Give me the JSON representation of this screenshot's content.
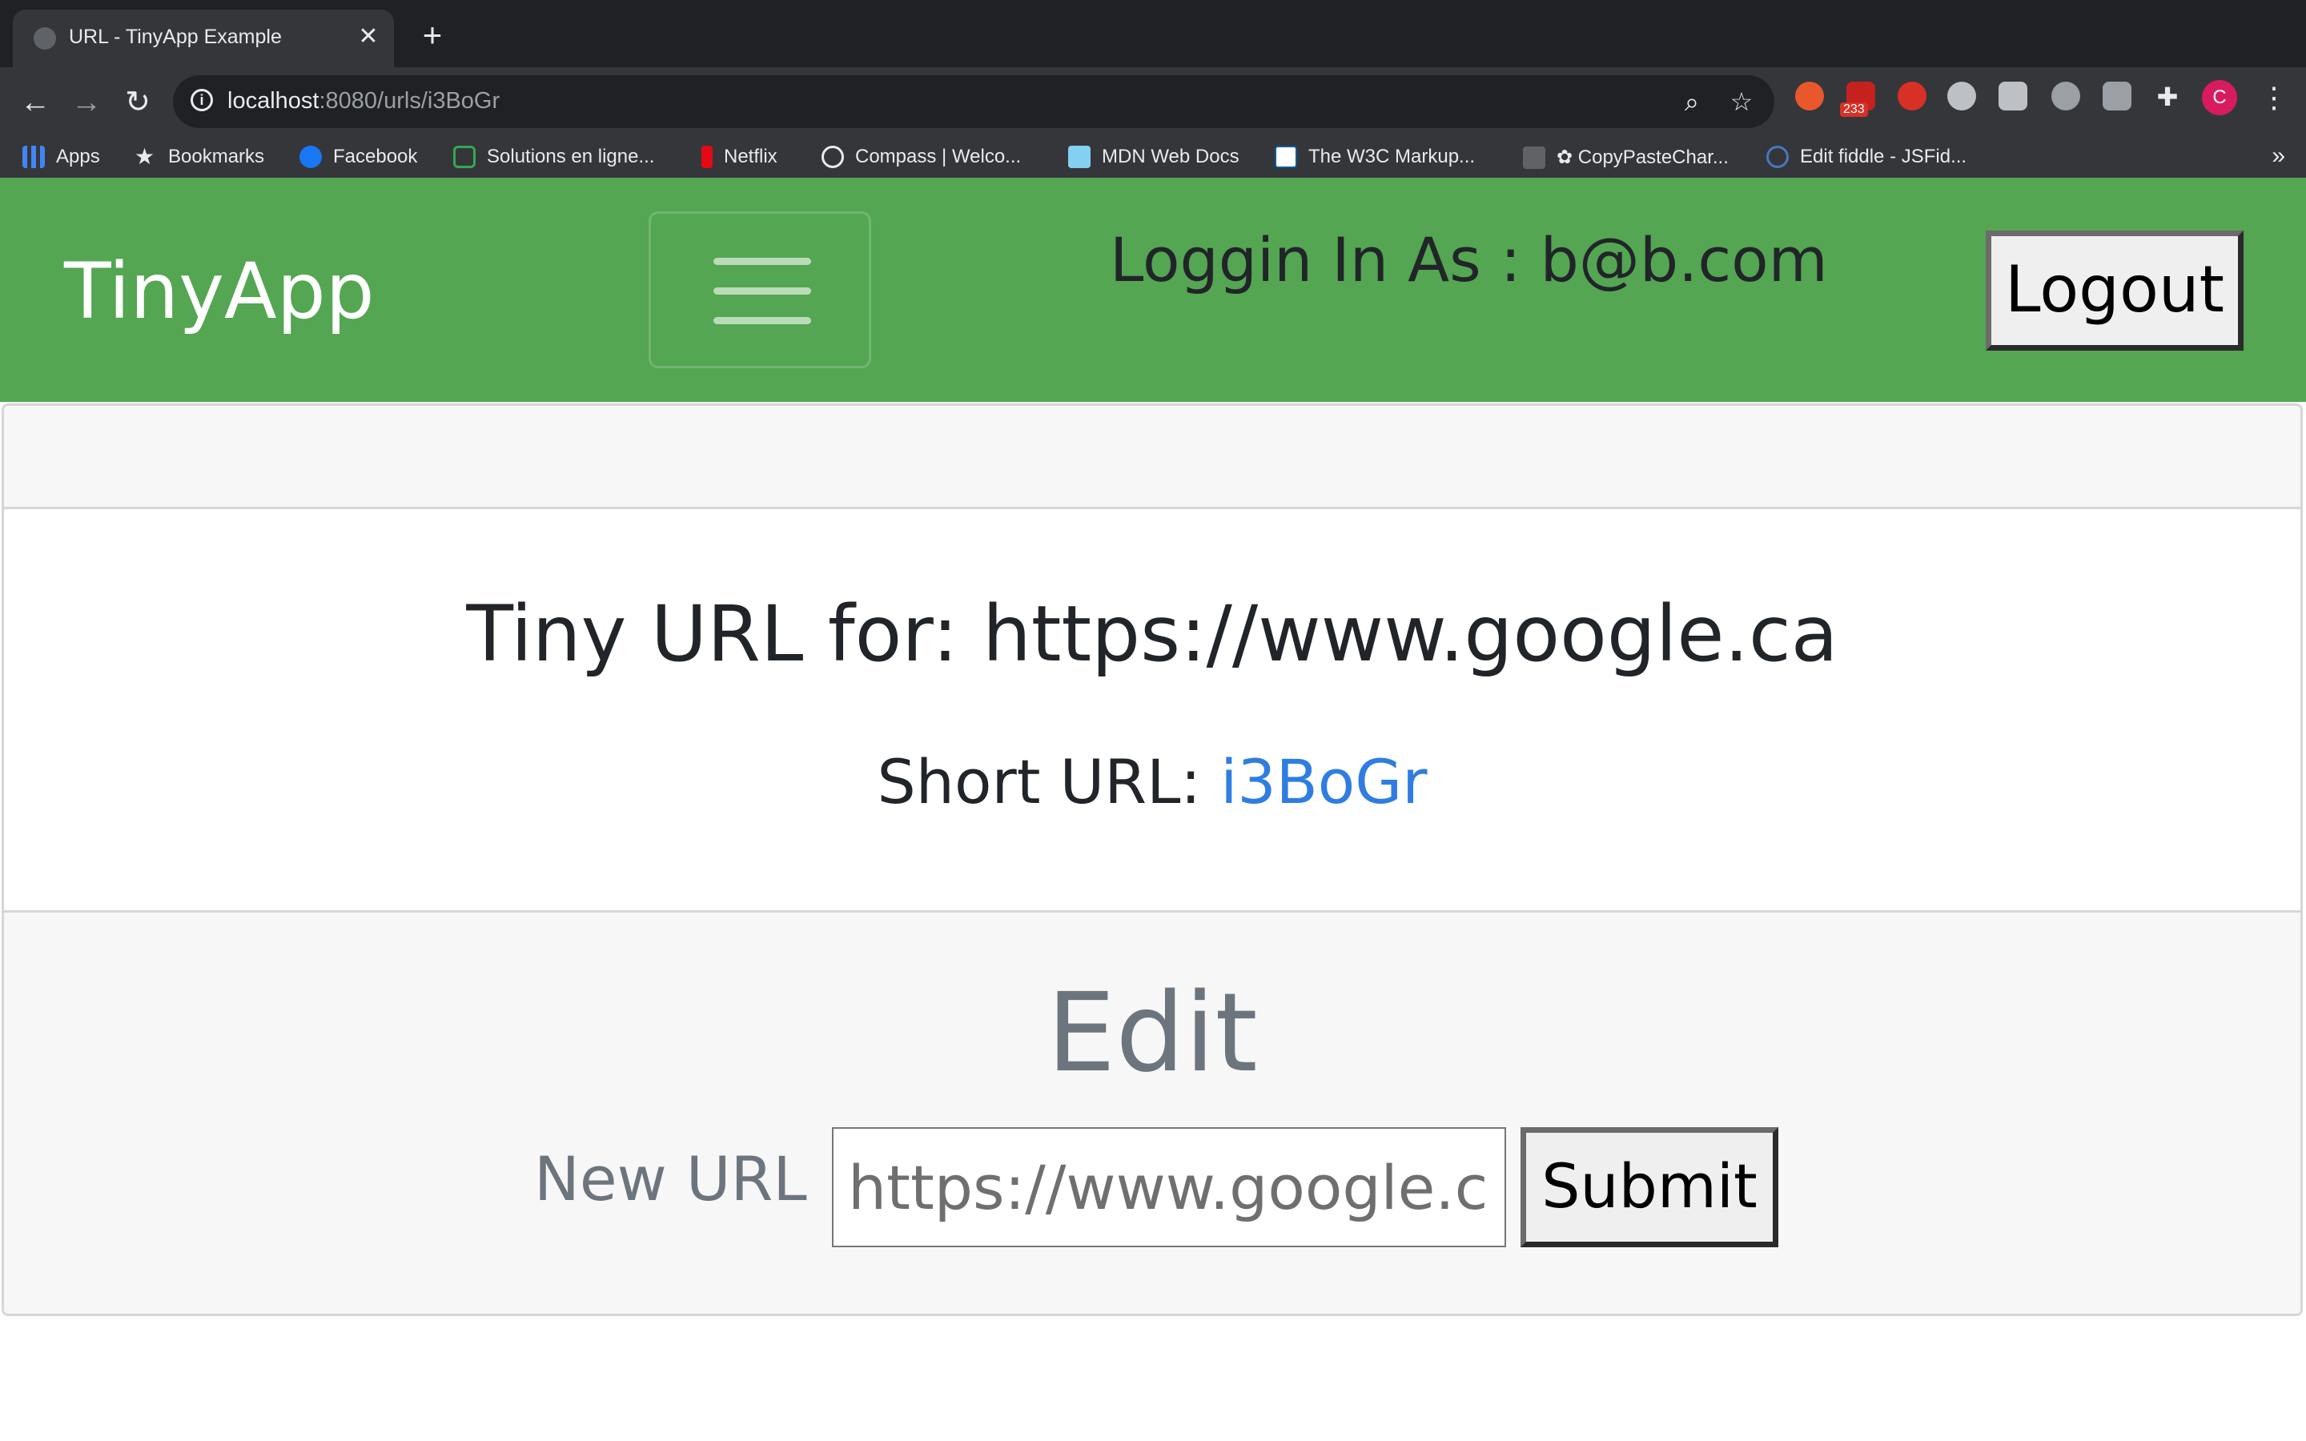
{
  "browser": {
    "tab": {
      "title": "URL - TinyApp Example",
      "close": "✕"
    },
    "new_tab": "+",
    "nav": {
      "back": "←",
      "forward": "→",
      "reload": "↻"
    },
    "omnibox": {
      "host": "localhost",
      "path": ":8080/urls/i3BoGr"
    },
    "extensions": [
      {
        "name": "alert-extension-icon",
        "color": "#e8582c"
      },
      {
        "name": "gmail-extension-icon",
        "color": "#c5221f",
        "badge": "233"
      },
      {
        "name": "adblock-extension-icon",
        "color": "#d93025"
      },
      {
        "name": "bulb-extension-icon",
        "color": "#bdc1c6"
      },
      {
        "name": "doc-extension-icon",
        "color": "#bdc1c6"
      },
      {
        "name": "circle-extension-icon",
        "color": "#9aa0a6"
      },
      {
        "name": "k-extension-icon",
        "color": "#9aa0a6"
      },
      {
        "name": "puzzle-extension-icon",
        "color": "#e8eaed"
      }
    ],
    "profile_initial": "C",
    "bookmarks": [
      {
        "label": "Apps",
        "icon": "apps-grid-icon",
        "color": "#4285f4"
      },
      {
        "label": "Bookmarks",
        "icon": "star-icon",
        "color": "#e8eaed"
      },
      {
        "label": "Facebook",
        "icon": "facebook-icon",
        "color": "#1877f2"
      },
      {
        "label": "Solutions en ligne...",
        "icon": "hexagon-icon",
        "color": "#34a853"
      },
      {
        "label": "Netflix",
        "icon": "netflix-icon",
        "color": "#e50914"
      },
      {
        "label": "Compass | Welco...",
        "icon": "compass-icon",
        "color": "#e8eaed"
      },
      {
        "label": "MDN Web Docs",
        "icon": "mdn-icon",
        "color": "#83d0f2"
      },
      {
        "label": "The W3C Markup...",
        "icon": "w3c-icon",
        "color": "#005a9c"
      },
      {
        "label": "✿ CopyPasteChar...",
        "icon": "copypaste-icon",
        "color": "#9aa0a6"
      },
      {
        "label": "Edit fiddle - JSFid...",
        "icon": "jsfiddle-icon",
        "color": "#4679bd"
      }
    ],
    "bookmarks_more": "»"
  },
  "app": {
    "brand": "TinyApp",
    "logged_in_text": "Loggin In As : b@b.com",
    "logout_label": "Logout",
    "card": {
      "title": "Tiny URL for: https://www.google.ca",
      "short_url_label": "Short URL: ",
      "short_url_value": "i3BoGr",
      "edit_heading": "Edit",
      "new_url_label": "New URL :",
      "new_url_value": "https://www.google.ca",
      "submit_label": "Submit"
    },
    "colors": {
      "navbar": "#54a652",
      "link": "#2f7de1",
      "muted": "#6c757d"
    }
  }
}
